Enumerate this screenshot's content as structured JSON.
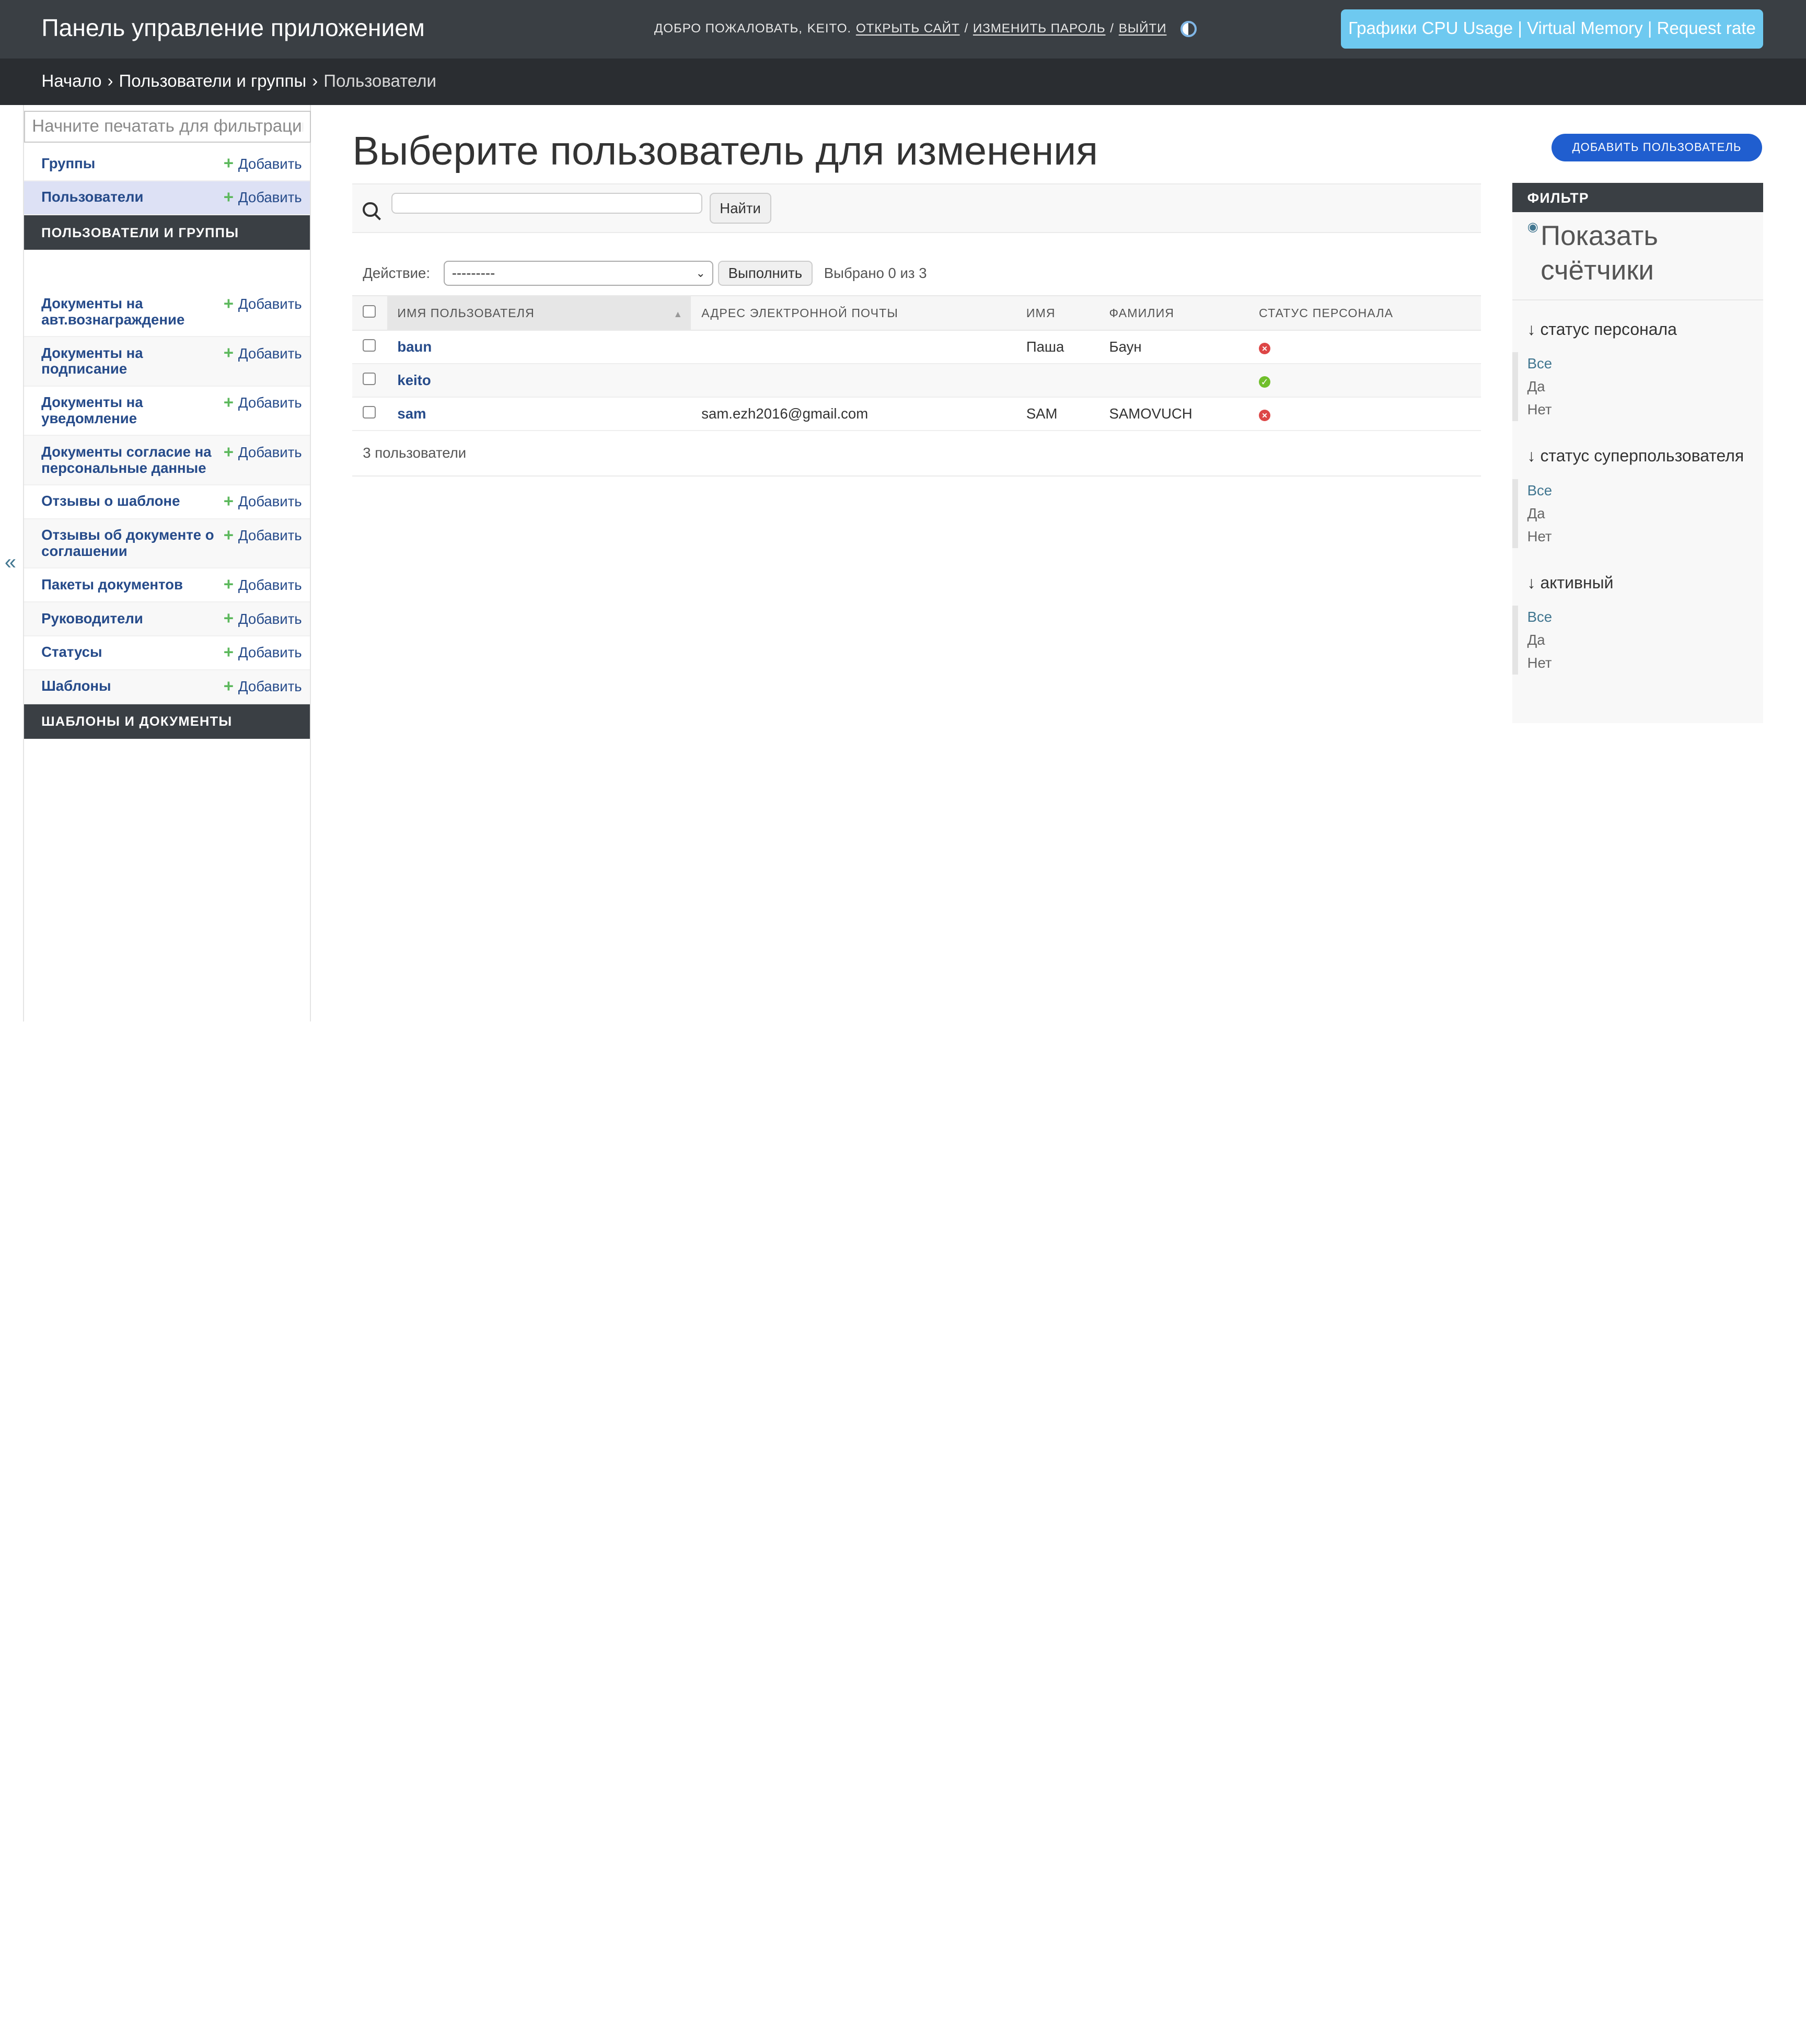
{
  "header": {
    "brand": "Панель управление приложением",
    "welcome": "Добро пожаловать,",
    "username": "keito.",
    "view_site": "Открыть сайт",
    "change_password": "Изменить пароль",
    "logout": "Выйти",
    "graphs_button": "Графики CPU Usage | Virtual Memory | Request rate",
    "accent": "#6ec9f0"
  },
  "breadcrumbs": {
    "home": "Начало",
    "app": "Пользователи и группы",
    "current": "Пользователи"
  },
  "sidebar": {
    "filter_placeholder": "Начните печатать для фильтрации...",
    "add_label": "Добавить",
    "auth_models": [
      {
        "name": "Группы"
      },
      {
        "name": "Пользователи"
      }
    ],
    "auth_caption": "Пользователи и группы",
    "docs_models": [
      {
        "name": "Документы на авт.вознаграждение"
      },
      {
        "name": "Документы на подписание"
      },
      {
        "name": "Документы на уведомление"
      },
      {
        "name": "Документы согласие на персональные данные"
      },
      {
        "name": "Отзывы о шаблоне"
      },
      {
        "name": "Отзывы об документе о соглашении"
      },
      {
        "name": "Пакеты документов"
      },
      {
        "name": "Руководители"
      },
      {
        "name": "Статусы"
      },
      {
        "name": "Шаблоны"
      }
    ],
    "docs_caption": "Шаблоны и документы",
    "collapse": "«"
  },
  "main": {
    "title": "Выберите пользователь для изменения",
    "add_button": "Добавить пользователь",
    "search_button": "Найти",
    "action_label": "Действие:",
    "action_value": "---------",
    "run_button": "Выполнить",
    "selected_counter": "Выбрано 0 из 3",
    "columns": [
      "Имя пользователя",
      "Адрес электронной почты",
      "Имя",
      "Фамилия",
      "Статус персонала"
    ],
    "rows": [
      {
        "username": "baun",
        "email": "",
        "first_name": "Паша",
        "last_name": "Баун",
        "staff": "no"
      },
      {
        "username": "keito",
        "email": "",
        "first_name": "",
        "last_name": "",
        "staff": "yes"
      },
      {
        "username": "sam",
        "email": "sam.ezh2016@gmail.com",
        "first_name": "SAM",
        "last_name": "SAMOVUCH",
        "staff": "no"
      }
    ],
    "paginator": "3 пользователи"
  },
  "filter": {
    "caption": "Фильтр",
    "show_counts": "Показать счётчики",
    "groups": [
      {
        "title": "статус персонала",
        "options": [
          "Все",
          "Да",
          "Нет"
        ]
      },
      {
        "title": "статус суперпользователя",
        "options": [
          "Все",
          "Да",
          "Нет"
        ]
      },
      {
        "title": "активный",
        "options": [
          "Все",
          "Да",
          "Нет"
        ]
      }
    ]
  }
}
